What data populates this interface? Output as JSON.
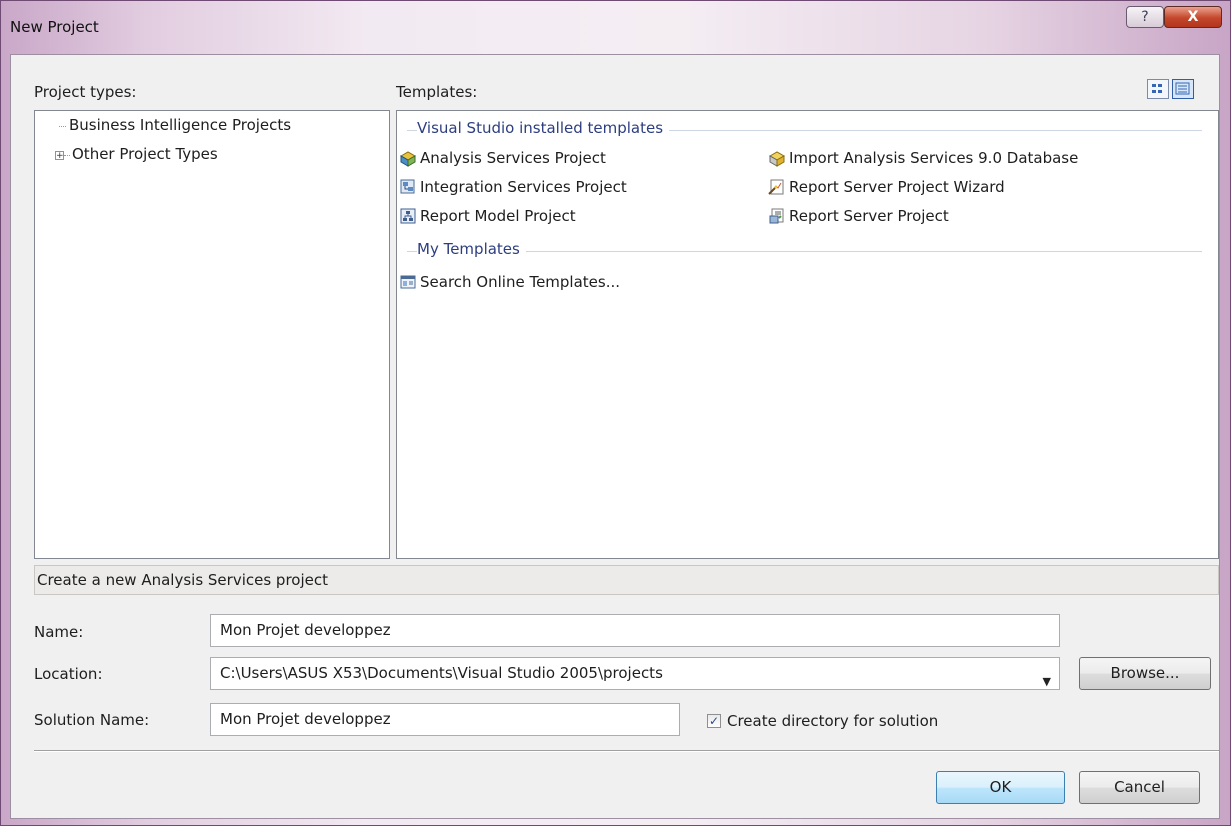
{
  "window": {
    "title": "New Project",
    "help_label": "?",
    "close_label": "X"
  },
  "project_types": {
    "label": "Project types:",
    "items": [
      {
        "label": "Business Intelligence Projects",
        "selected": true
      },
      {
        "label": "Other Project Types",
        "expandable": true
      }
    ],
    "expander_symbol": "+"
  },
  "templates": {
    "label": "Templates:",
    "groups": [
      {
        "title": "Visual Studio installed templates",
        "items": [
          {
            "label": "Analysis Services Project",
            "icon": "analysis-services-icon"
          },
          {
            "label": "Import Analysis Services 9.0 Database",
            "icon": "import-database-icon"
          },
          {
            "label": "Integration Services Project",
            "icon": "integration-services-icon"
          },
          {
            "label": "Report Server Project Wizard",
            "icon": "report-wizard-icon"
          },
          {
            "label": "Report Model Project",
            "icon": "report-model-icon"
          },
          {
            "label": "Report Server Project",
            "icon": "report-server-icon"
          }
        ]
      },
      {
        "title": "My Templates",
        "items": [
          {
            "label": "Search Online Templates...",
            "icon": "search-online-icon"
          }
        ]
      }
    ]
  },
  "description": "Create a new Analysis Services project",
  "form": {
    "name_label": "Name:",
    "name_value": "Mon Projet developpez",
    "location_label": "Location:",
    "location_value": "C:\\Users\\ASUS X53\\Documents\\Visual Studio 2005\\projects",
    "browse_label": "Browse...",
    "solution_label": "Solution Name:",
    "solution_value": "Mon Projet developpez",
    "create_dir_label": "Create directory for solution",
    "create_dir_checked": true
  },
  "buttons": {
    "ok": "OK",
    "cancel": "Cancel"
  },
  "colors": {
    "group_title": "#2d3e80",
    "ok_accent": "#3c7fb1"
  }
}
